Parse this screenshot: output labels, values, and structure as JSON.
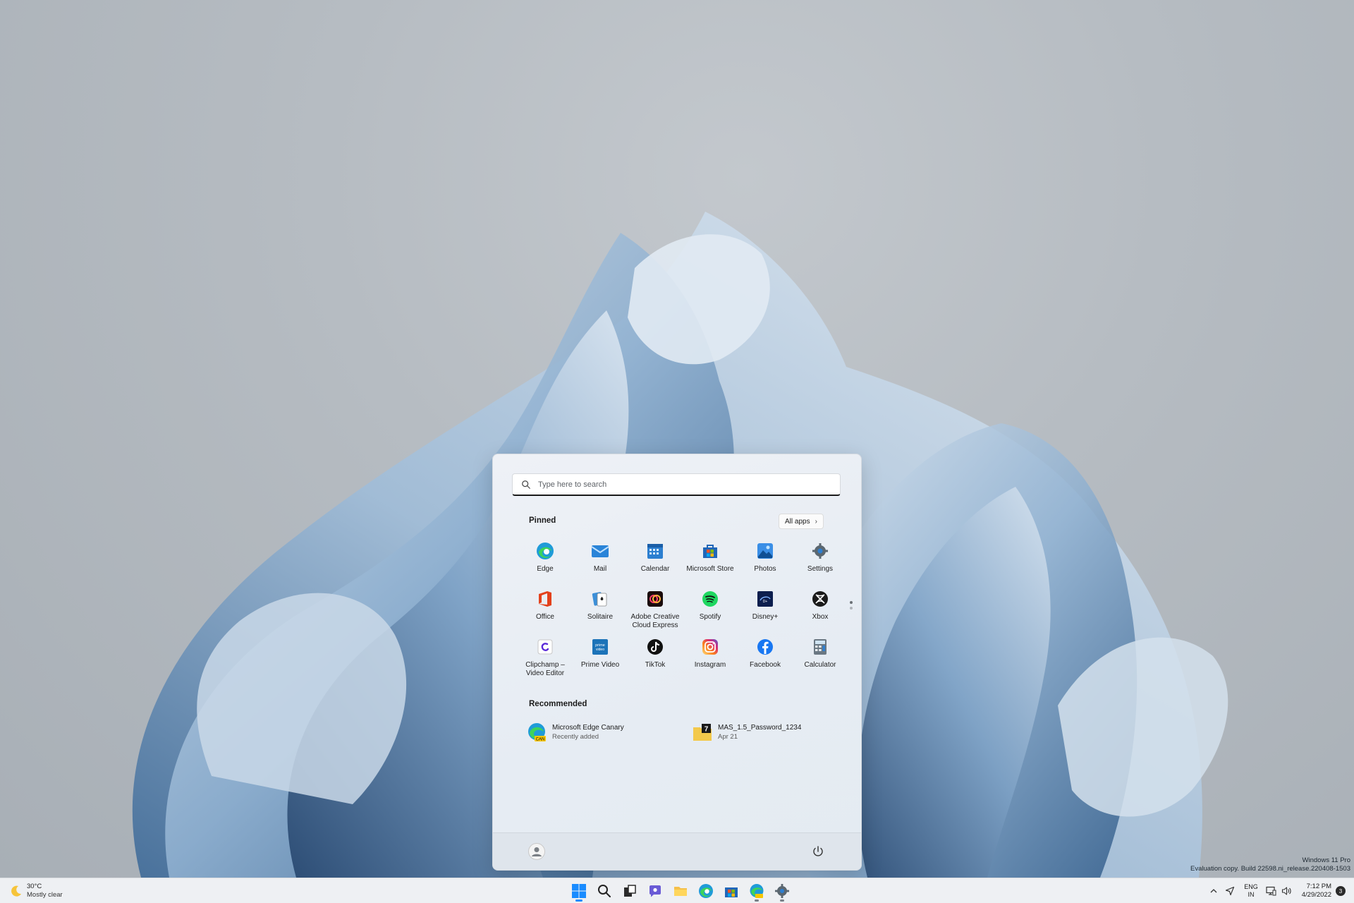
{
  "watermark": {
    "line1": "Windows 11 Pro",
    "line2": "Evaluation copy. Build 22598.ni_release.220408-1503"
  },
  "start_menu": {
    "search": {
      "placeholder": "Type here to search"
    },
    "pinned": {
      "title": "Pinned",
      "all_apps_label": "All apps",
      "apps": [
        {
          "label": "Edge",
          "icon": "edge-icon"
        },
        {
          "label": "Mail",
          "icon": "mail-icon"
        },
        {
          "label": "Calendar",
          "icon": "calendar-icon"
        },
        {
          "label": "Microsoft Store",
          "icon": "store-icon"
        },
        {
          "label": "Photos",
          "icon": "photos-icon"
        },
        {
          "label": "Settings",
          "icon": "settings-icon"
        },
        {
          "label": "Office",
          "icon": "office-icon"
        },
        {
          "label": "Solitaire",
          "icon": "solitaire-icon"
        },
        {
          "label": "Adobe Creative Cloud Express",
          "icon": "adobe-express-icon"
        },
        {
          "label": "Spotify",
          "icon": "spotify-icon"
        },
        {
          "label": "Disney+",
          "icon": "disney-plus-icon"
        },
        {
          "label": "Xbox",
          "icon": "xbox-icon"
        },
        {
          "label": "Clipchamp – Video Editor",
          "icon": "clipchamp-icon"
        },
        {
          "label": "Prime Video",
          "icon": "prime-video-icon"
        },
        {
          "label": "TikTok",
          "icon": "tiktok-icon"
        },
        {
          "label": "Instagram",
          "icon": "instagram-icon"
        },
        {
          "label": "Facebook",
          "icon": "facebook-icon"
        },
        {
          "label": "Calculator",
          "icon": "calculator-icon"
        }
      ]
    },
    "recommended": {
      "title": "Recommended",
      "items": [
        {
          "name": "Microsoft Edge Canary",
          "sub": "Recently added",
          "icon": "edge-canary-icon"
        },
        {
          "name": "MAS_1.5_Password_1234",
          "sub": "Apr 21",
          "icon": "archive-file-icon"
        }
      ]
    }
  },
  "taskbar": {
    "weather": {
      "temp": "30°C",
      "condition": "Mostly clear",
      "icon": "moon-icon"
    },
    "center_icons": [
      "start-icon",
      "search-icon",
      "task-view-icon",
      "chat-icon",
      "file-explorer-icon",
      "edge-icon",
      "store-icon",
      "edge-canary-icon",
      "settings-icon"
    ],
    "tray": {
      "lang_line1": "ENG",
      "lang_line2": "IN",
      "time": "7:12 PM",
      "date": "4/29/2022",
      "notification_count": "3"
    }
  },
  "colors": {
    "accent": "#0067c0",
    "start_menu_bg": "#e9eef4",
    "taskbar_bg": "#eef0f3"
  }
}
